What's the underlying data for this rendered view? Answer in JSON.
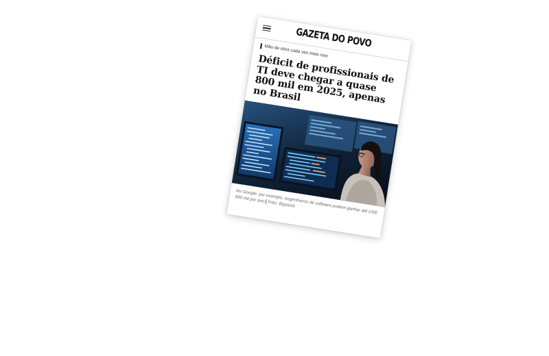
{
  "header": {
    "brand": "GAZETA DO POVO",
    "menu_icon": "hamburger-menu-icon"
  },
  "article": {
    "kicker": "Mão de obra cada vez mais rara",
    "headline": "Déficit de profissionais de TI deve chegar a quase 800 mil em 2025, apenas no Brasil",
    "image_description_icon": "photo-developer-monitors",
    "caption": "No Google, por exemplo, engenheiros de software podem ganhar até US$ 650 mil por ano",
    "credit": "Foto: Bigstock"
  },
  "colors": {
    "text": "#111111",
    "caption": "#666666",
    "screen_glow": "#2f6fb3"
  }
}
